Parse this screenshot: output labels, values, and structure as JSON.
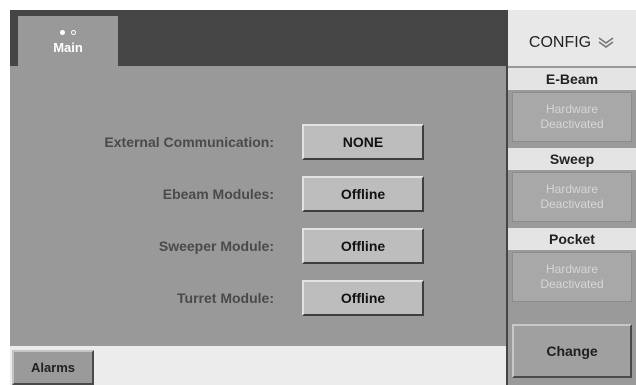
{
  "main": {
    "tab_label": "Main",
    "page_indicator": {
      "current": 1,
      "total": 2
    },
    "status_rows": [
      {
        "label": "External Communication:",
        "value": "NONE"
      },
      {
        "label": "Ebeam Modules:",
        "value": "Offline"
      },
      {
        "label": "Sweeper Module:",
        "value": "Offline"
      },
      {
        "label": "Turret Module:",
        "value": "Offline"
      }
    ],
    "alarms_label": "Alarms"
  },
  "config": {
    "title": "CONFIG",
    "title_icon": "double-chevron-down-icon",
    "sections": [
      {
        "title": "E-Beam",
        "status_line1": "Hardware",
        "status_line2": "Deactivated"
      },
      {
        "title": "Sweep",
        "status_line1": "Hardware",
        "status_line2": "Deactivated"
      },
      {
        "title": "Pocket",
        "status_line1": "Hardware",
        "status_line2": "Deactivated"
      }
    ],
    "change_label": "Change"
  },
  "colors": {
    "frame": "#454545",
    "panel": "#999999",
    "value_box": "#bdbdbd",
    "section_header": "#e4e4e4"
  }
}
